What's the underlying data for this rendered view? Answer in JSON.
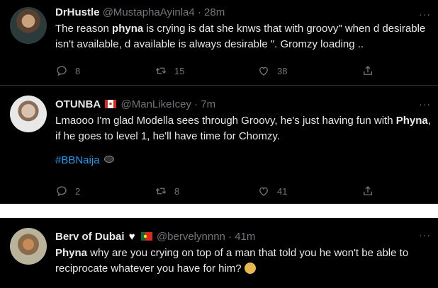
{
  "tweets": [
    {
      "name": "DrHustle",
      "handle": "@MustaphaAyinla4 · 28m",
      "text_parts": [
        "The reason ",
        "phyna",
        " is crying is dat she knws that with groovy\" when d desirable isn't available, d available is always desirable \". Gromzy loading .."
      ],
      "replies": "8",
      "retweets": "15",
      "likes": "38"
    },
    {
      "name": "OTUNBA",
      "handle": "@ManLikeIcey · 7m",
      "text_parts": [
        "Lmaooo I'm glad Modella sees through Groovy, he's just having fun with ",
        "Phyna",
        ", if he goes to level 1, he'll have time for Chomzy."
      ],
      "hashtag": "#BBNaija",
      "replies": "2",
      "retweets": "8",
      "likes": "41"
    },
    {
      "name": "Berv of Dubai",
      "handle": "@bervelynnnn · 41m",
      "text_parts": [
        "Phyna",
        " why are you crying on top of a man that told you he won't be able to reciprocate whatever you have for him?"
      ]
    }
  ],
  "icons": {
    "more": "more-icon",
    "reply": "reply-icon",
    "retweet": "retweet-icon",
    "like": "like-icon",
    "share": "share-icon",
    "flag_canada": "canada-flag-icon",
    "flag_portugal": "portugal-flag-icon",
    "heart": "white-heart-icon",
    "eye": "eye-icon",
    "emoji": "woman-gesturing-emoji"
  },
  "colors": {
    "background": "#000000",
    "text": "#e7e9ea",
    "secondary": "#71767b",
    "link": "#1d9bf0"
  }
}
